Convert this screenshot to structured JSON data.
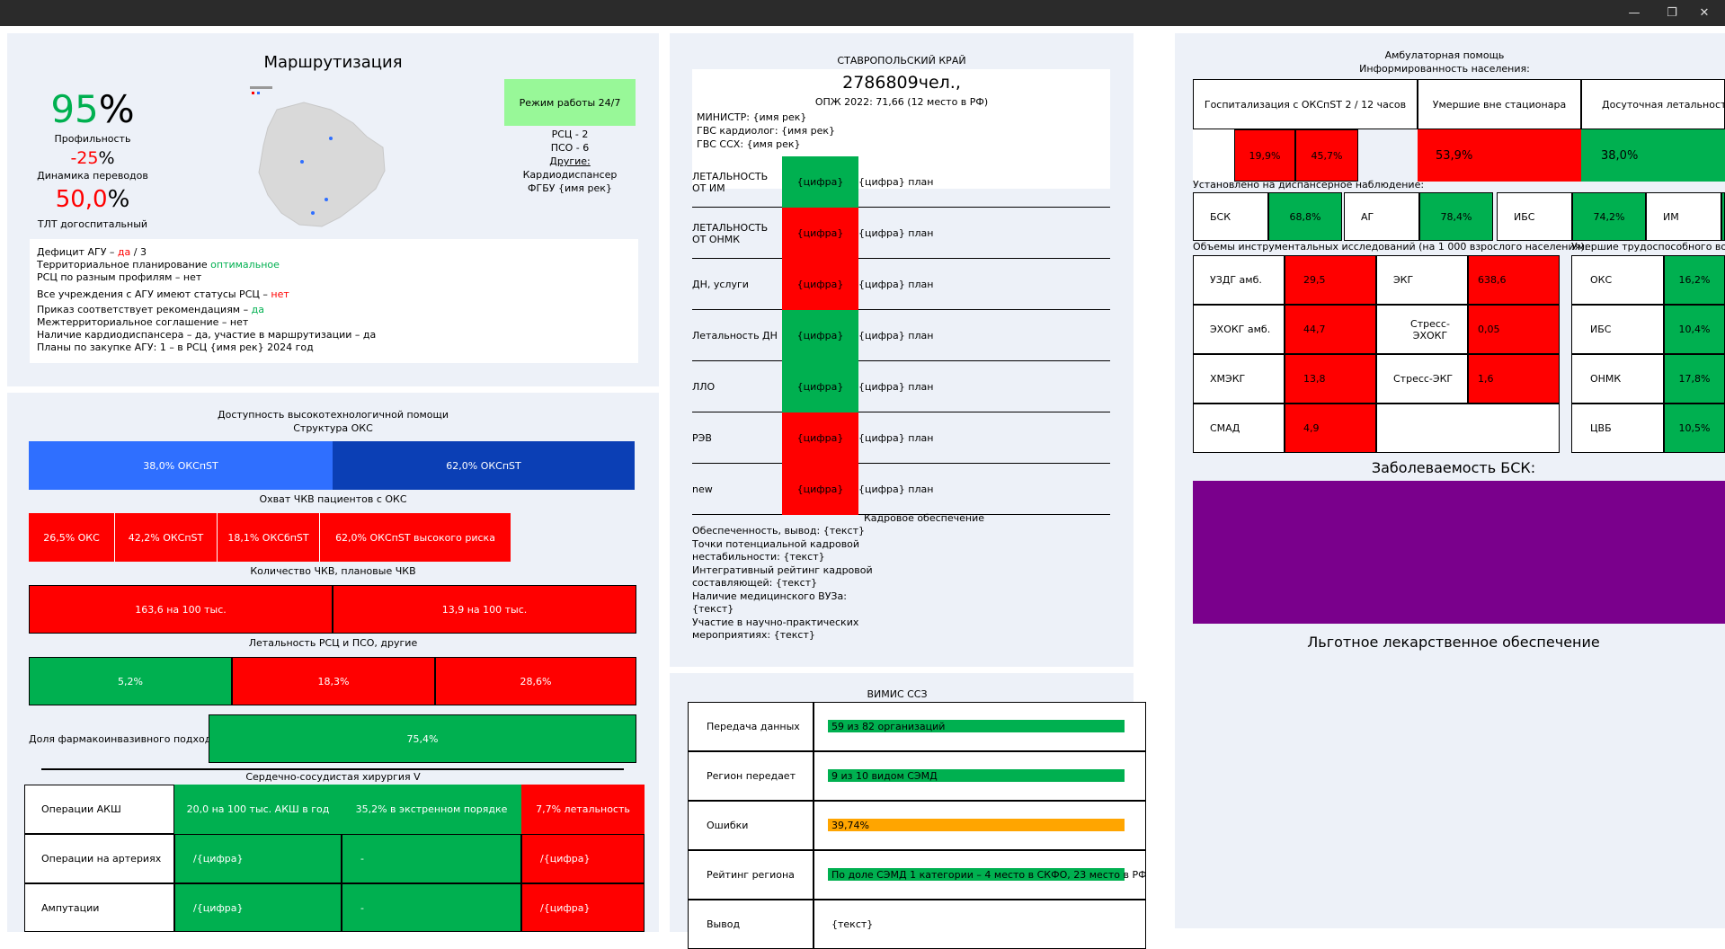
{
  "titlebar": {
    "min": "—",
    "restore": "❐",
    "close": "✕"
  },
  "left": {
    "title": "Маршрутизация",
    "profile_pct_num": "95",
    "profile_pct_sign": "%",
    "profile_label": "Профильность",
    "dynamics_num": "-25",
    "dynamics_sign": "%",
    "dynamics_label": "Динамика переводов",
    "tlt_num": "50,0",
    "tlt_sign": "%",
    "tlt_label": "ТЛТ догоспитальный",
    "mode_button": "Режим работы 24/7",
    "rsc": "РСЦ - 2",
    "pso": "ПСО - 6",
    "other": "Другие:",
    "cardio": "Кардиодиспансер",
    "fgbu": "ФГБУ {имя рек}",
    "info": {
      "l1a": "Дефицит АГУ – ",
      "l1b": "да",
      "l1c": " / 3",
      "l2a": "Территориальное планирование ",
      "l2b": "оптимальное",
      "l3": "РСЦ по разным профилям – нет",
      "l4a": "Все учреждения с АГУ имеют статусы РСЦ – ",
      "l4b": "нет",
      "l5a": "Приказ соответствует рекомендациям – ",
      "l5b": "да",
      "l6": "Межтерриториальное соглашение – нет",
      "l7": "Наличие кардиодиспансера – да, участие в маршрутизации – да",
      "l8": "Планы по закупке АГУ: 1 – в РСЦ {имя рек} 2024 год"
    },
    "hitech_title": "Доступность высокотехнологичной помощи",
    "oks_title": "Структура ОКС",
    "oks1": "38,0% ОКСпST",
    "oks2": "62,0% ОКСпST",
    "chkv_title": "Охват ЧКВ пациентов с ОКС",
    "chkv1": "26,5% ОКС",
    "chkv2": "42,2% ОКСпST",
    "chkv3": "18,1% ОКСбпST",
    "chkv4": "62,0% ОКСпST высокого риска",
    "qty_title": "Количество ЧКВ, плановые ЧКВ",
    "qty1": "163,6 на 100 тыс.",
    "qty2": "13,9 на 100 тыс.",
    "let_title": "Летальность РСЦ и ПСО, другие",
    "let1": "5,2%",
    "let2": "18,3%",
    "let3": "28,6%",
    "pharma_label": "Доля фармакоинвазивного подхода",
    "pharma_val": "75,4%",
    "surg_title": "Сердечно-сосудистая хирургия V",
    "surg_rows": [
      {
        "name": "Операции АКШ",
        "c1": "20,0 на 100 тыс. АКШ в год",
        "c2": "35,2% в экстренном порядке",
        "c3": "7,7% летальность"
      },
      {
        "name": "Операции на артериях",
        "c1": "/{цифра}",
        "c2": "-",
        "c3": "/{цифра}"
      },
      {
        "name": "Ампутации",
        "c1": "/{цифра}",
        "c2": "-",
        "c3": "/{цифра}"
      }
    ]
  },
  "mid": {
    "region": "СТАВРОПОЛЬСКИЙ КРАЙ",
    "population": "2786809чел.,",
    "opzh": "ОПЖ 2022: 71,66 (12 место в РФ)",
    "minister": "МИНИСТР: {имя рек}",
    "gvs_cardio": "ГВС кардиолог: {имя рек}",
    "gvs_ssh": "ГВС ССХ: {имя рек}",
    "rows": [
      {
        "label": "ЛЕТАЛЬНОСТЬ ОТ ИМ",
        "value": "{цифра}",
        "plan": "{цифра} план",
        "color": "#00b050"
      },
      {
        "label": "ЛЕТАЛЬНОСТЬ ОТ ОНМК",
        "value": "{цифра}",
        "plan": "{цифра} план",
        "color": "#ff0000"
      },
      {
        "label": "ДН, услуги",
        "value": "{цифра}",
        "plan": "{цифра} план",
        "color": "#ff0000"
      },
      {
        "label": "Летальность ДН",
        "value": "{цифра}",
        "plan": "{цифра} план",
        "color": "#00b050"
      },
      {
        "label": "ЛЛО",
        "value": "{цифра}",
        "plan": "{цифра} план",
        "color": "#00b050"
      },
      {
        "label": "РЭВ",
        "value": "{цифра}",
        "plan": "{цифра} план",
        "color": "#ff0000"
      },
      {
        "label": "new",
        "value": "{цифра}",
        "plan": "{цифра} план",
        "color": "#ff0000"
      }
    ],
    "staff_title": "Кадровое обеспечение",
    "staff_lines": [
      "Обеспеченность, вывод: {текст}",
      "Точки потенциальной кадровой",
      "нестабильности: {текст}",
      "Интегративный рейтинг кадровой",
      "составляющей: {текст}",
      "Наличие медицинского ВУЗа:",
      "{текст}",
      "Участие в научно-практических",
      "мероприятиях: {текст}"
    ],
    "vimis_title": "ВИМИС   ССЗ",
    "vimis_rows": [
      {
        "name": "Передача данных",
        "value": "59 из 82 организаций",
        "bar": 1.0,
        "color": "#00b050"
      },
      {
        "name": "Регион передает",
        "value": "9 из 10 видом СЭМД",
        "bar": 1.0,
        "color": "#00b050"
      },
      {
        "name": "Ошибки",
        "value": "39,74%",
        "bar": 1.0,
        "color": "#ffa500"
      },
      {
        "name": "Рейтинг региона",
        "value": "По доле СЭМД 1 категории – 4 место в СКФО, 23 место в РФ",
        "bar": 1.0,
        "color": "#00b050"
      },
      {
        "name": "Вывод",
        "value": "{текст}",
        "bar": 0,
        "color": ""
      }
    ]
  },
  "right": {
    "amb_title": "Амбулаторная помощь",
    "inform_title": "Информированность населения:",
    "h1": "Госпитализация с ОКСпST 2 / 12 часов",
    "h2": "Умершие вне стационара",
    "h3": "Досуточная летальность",
    "v1a": "19,9%",
    "v1b": "45,7%",
    "v2": "53,9%",
    "v3": "38,0%",
    "disp_title": "Установлено на диспансерное наблюдение:",
    "disp": [
      {
        "name": "БСК",
        "value": "68,8%"
      },
      {
        "name": "АГ",
        "value": "78,4%"
      },
      {
        "name": "ИБС",
        "value": "74,2%"
      },
      {
        "name": "ИМ",
        "value": ""
      }
    ],
    "instr_title": "Объемы инструментальных исследований (на 1 000 взрослого населения):",
    "dead_title": "Умершие трудоспособного возраста",
    "instr": [
      {
        "n1": "УЗДГ амб.",
        "v1": "29,5",
        "n2": "ЭКГ",
        "v2": "638,6"
      },
      {
        "n1": "ЭХОКГ амб.",
        "v1": "44,7",
        "n2": "Стресс-ЭХОКГ",
        "v2": "0,05"
      },
      {
        "n1": "ХМЭКГ",
        "v1": "13,8",
        "n2": "Стресс-ЭКГ",
        "v2": "1,6"
      },
      {
        "n1": "СМАД",
        "v1": "4,9",
        "n2": "",
        "v2": ""
      }
    ],
    "dead": [
      {
        "name": "ОКС",
        "value": "16,2%"
      },
      {
        "name": "ИБС",
        "value": "10,4%"
      },
      {
        "name": "ОНМК",
        "value": "17,8%"
      },
      {
        "name": "ЦВБ",
        "value": "10,5%"
      }
    ],
    "bsk_title": "Заболеваемость БСК:",
    "llo_title": "Льготное лекарственное обеспечение"
  }
}
